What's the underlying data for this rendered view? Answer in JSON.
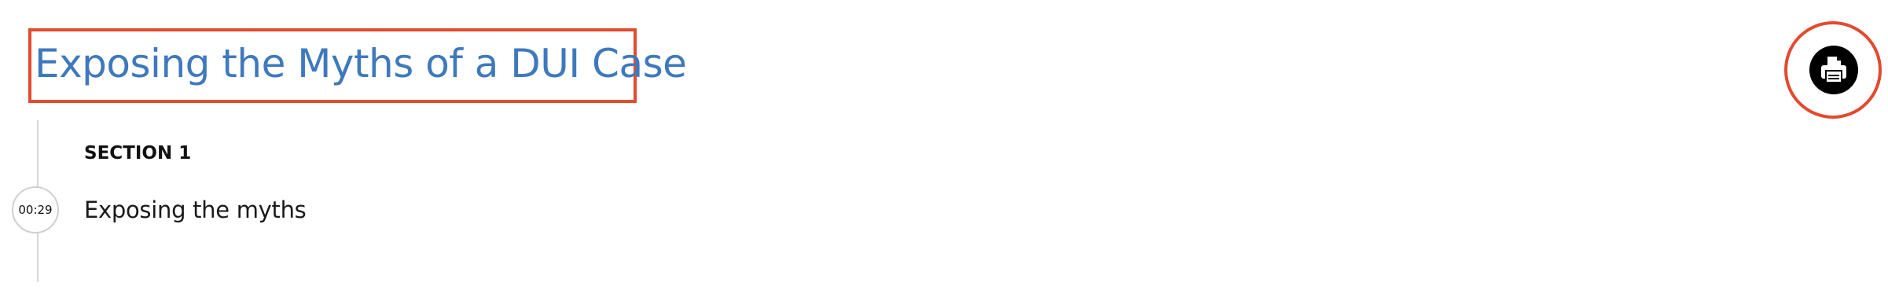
{
  "course": {
    "title": "Exposing the Myths of a DUI Case"
  },
  "toolbar": {
    "print_icon": "printer-icon"
  },
  "outline": {
    "sections": [
      {
        "heading": "SECTION 1",
        "lessons": [
          {
            "duration": "00:29",
            "title": "Exposing the myths"
          }
        ]
      }
    ]
  },
  "colors": {
    "title": "#3f79bd",
    "highlight": "#e34a2f",
    "print_button": "#000000",
    "timeline": "#d8d8d8"
  }
}
